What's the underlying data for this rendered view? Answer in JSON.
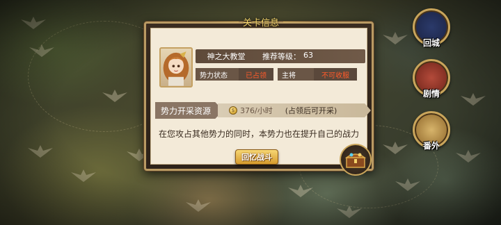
{
  "dialog": {
    "title": "关卡信息",
    "stage_name": "神之大教堂",
    "recommend_label": "推荐等级：",
    "recommend_level": "63",
    "faction_status_label": "势力状态",
    "faction_status_value": "已占领",
    "general_label": "主将",
    "general_value": "不可收服",
    "resource_tag": "势力开采资源",
    "resource_rate": "376/小时",
    "resource_note": "(占领后可开采)",
    "description": "在您攻占其他势力的同时，本势力也在提升自己的战力",
    "battle_button": "回忆战斗"
  },
  "side_menu": {
    "return_city": "回城",
    "story": "剧情",
    "extra": "番外"
  },
  "colors": {
    "accent_gold": "#e8c66a",
    "status_red": "#ff5a2a",
    "panel_bg": "#f3ead8"
  }
}
